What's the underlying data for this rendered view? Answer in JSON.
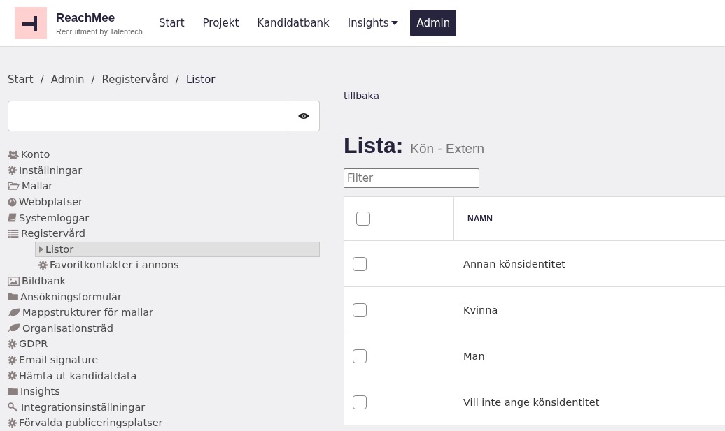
{
  "brand": {
    "name": "ReachMee",
    "tagline": "Recruitment by Talentech"
  },
  "nav": [
    {
      "label": "Start",
      "selected": false,
      "dropdown": false
    },
    {
      "label": "Projekt",
      "selected": false,
      "dropdown": false
    },
    {
      "label": "Kandidatbank",
      "selected": false,
      "dropdown": false
    },
    {
      "label": "Insights",
      "selected": false,
      "dropdown": true
    },
    {
      "label": "Admin",
      "selected": true,
      "dropdown": false
    }
  ],
  "breadcrumb": {
    "separator": "/",
    "items": [
      "Start",
      "Admin",
      "Registervård",
      "Listor"
    ]
  },
  "sidebar": {
    "items": [
      {
        "label": "Konto",
        "selected": false
      },
      {
        "label": "Inställningar",
        "selected": false
      },
      {
        "label": "Mallar",
        "selected": false
      },
      {
        "label": "Webbplatser",
        "selected": false
      },
      {
        "label": "Systemloggar",
        "selected": false
      },
      {
        "label": "Registervård",
        "selected": false,
        "children": [
          {
            "label": "Listor",
            "selected": true
          },
          {
            "label": "Favoritkontakter i annons",
            "selected": false
          }
        ]
      },
      {
        "label": "Bildbank",
        "selected": false
      },
      {
        "label": "Ansökningsformulär",
        "selected": false
      },
      {
        "label": "Mappstrukturer för mallar",
        "selected": false
      },
      {
        "label": "Organisationsträd",
        "selected": false
      },
      {
        "label": "GDPR",
        "selected": false
      },
      {
        "label": "Email signature",
        "selected": false
      },
      {
        "label": "Hämta ut kandidatdata",
        "selected": false
      },
      {
        "label": "Insights",
        "selected": false
      },
      {
        "label": "Integrationsinställningar",
        "selected": false
      },
      {
        "label": "Förvalda publiceringsplatser",
        "selected": false
      }
    ]
  },
  "back_link": "tillbaka",
  "title": "Lista:",
  "subtitle": "Kön - Extern",
  "filter": {
    "placeholder": "Filter"
  },
  "table": {
    "header_checked": false,
    "columns": [
      "NAMN"
    ],
    "rows": [
      {
        "name": "Annan könsidentitet",
        "checked": false
      },
      {
        "name": "Kvinna",
        "checked": false
      },
      {
        "name": "Man",
        "checked": false
      },
      {
        "name": "Vill inte ange könsidentitet",
        "checked": false
      }
    ]
  }
}
